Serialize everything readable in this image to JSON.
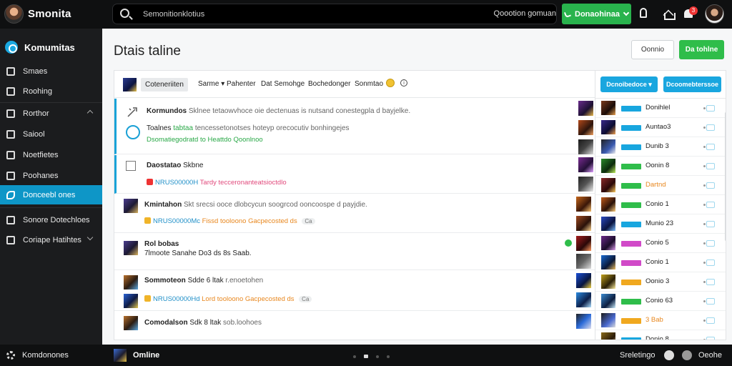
{
  "topbar": {
    "app_name": "Smonita",
    "search_placeholder": "Semonitionklotius",
    "search_right_text": "Qoootion gomuan",
    "cta_label": "Donaohinaa",
    "notification_count": "3"
  },
  "sidebar": {
    "brand_label": "Komumitas",
    "items": [
      {
        "label": "Smaes",
        "icon": "grid-icon"
      },
      {
        "label": "Roohing",
        "icon": "doc-icon"
      },
      {
        "label": "Rorthor",
        "icon": "list-icon"
      },
      {
        "label": "Saiool",
        "icon": "tv-icon"
      },
      {
        "label": "Noetfietes",
        "icon": "people-icon"
      },
      {
        "label": "Poohanes",
        "icon": "key-icon"
      },
      {
        "label": "Donceebl ones",
        "icon": "wrench-icon",
        "active": true
      },
      {
        "label": "Sonore Dotechloes",
        "icon": "gamepad-icon"
      },
      {
        "label": "Coriape Hatihtes",
        "icon": "chat-icon"
      }
    ]
  },
  "main": {
    "title": "Dtais taline",
    "btn_secondary": "Oonnio",
    "btn_primary": "Da tohlne"
  },
  "filters": {
    "chip": "Coteneriiten",
    "links": [
      "Sarme ▾",
      "Pahenter",
      "Dat Semohge",
      "Bochedonger",
      "Sonmtao"
    ]
  },
  "rows": [
    {
      "title": "Kormundos",
      "desc": "Sklnee tetaowvhoce oie dectenuas is nutsand conestegpla d bayjelke.",
      "sub": ""
    },
    {
      "title": "Toalnes",
      "highlight": "tabtaa",
      "desc": "tencessetonotses hoteyp orecocutiv bonhingejes",
      "sub": "Dsomatiegodratd to Heattdo Qoonlnoo"
    },
    {
      "title": "Daostatao",
      "title_b": "Skbne",
      "sub_id": "NRUS00000H",
      "sub_text": "Tardy tecceronanteatsioctdlo"
    },
    {
      "title": "Kmintahon",
      "desc": "Skt srecsi ooce dlobcycun soogrcod ooncoospe d payjdie.",
      "sub_id": "NRUS00000Mc",
      "sub_text": "Fissd tooloono Gacpecosted ds",
      "badge": "Ca"
    },
    {
      "title": "Rol bobas",
      "desc": "7lmoote  Sanahe Do3 ds 8s Saab."
    },
    {
      "title": "Sommoteon",
      "title_b": "Sdde 6 ltak",
      "desc": "r.enoetohen"
    },
    {
      "title": "",
      "sub_id": "NRUS00000Hd",
      "sub_text": "Lord tooloono Gacpecosted ds",
      "badge": "Ca"
    },
    {
      "title": "Comodalson",
      "title_b": "Sdk 8 ltak",
      "desc": "sob.loohoes"
    }
  ],
  "right_panel": {
    "btn1": "Dcnoibedoce ▾",
    "btn2": "Dcoomebterssoe",
    "rows": [
      {
        "name": "Donihlel",
        "tag_color": "#18a6df"
      },
      {
        "name": "Auntao3",
        "tag_color": "#18a6df"
      },
      {
        "name": "Dunib 3",
        "tag_color": "#18a6df"
      },
      {
        "name": "Oonin 8",
        "tag_color": "#2fbd4a"
      },
      {
        "name": "Dartnd",
        "tag_color": "#2fbd4a",
        "name_color": "#e8871e"
      },
      {
        "name": "Conio 1",
        "tag_color": "#2fbd4a"
      },
      {
        "name": "Munio 23",
        "tag_color": "#18a6df"
      },
      {
        "name": "Conio 5",
        "tag_color": "#d14ac8"
      },
      {
        "name": "Conio 1",
        "tag_color": "#d14ac8"
      },
      {
        "name": "Oonio 3",
        "tag_color": "#f0a81f"
      },
      {
        "name": "Conio 63",
        "tag_color": "#2fbd4a"
      },
      {
        "name": "3 Bab",
        "tag_color": "#f0a81f",
        "name_color": "#e8871e"
      },
      {
        "name": "Donio 8",
        "tag_color": "#18a6df"
      }
    ]
  },
  "bottombar": {
    "left_label": "Komdonones",
    "status": "Omline",
    "right_label": "Sreletingo",
    "right_label2": "Oeohe"
  }
}
